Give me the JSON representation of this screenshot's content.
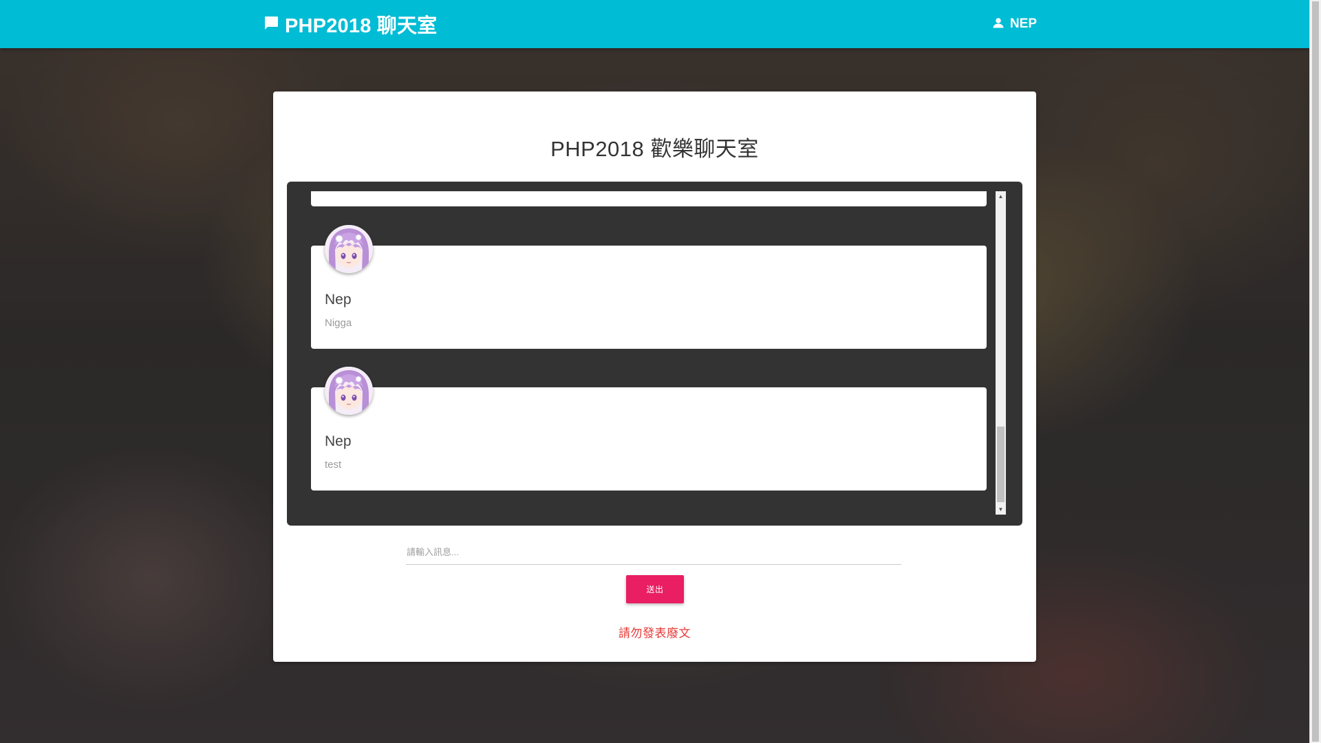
{
  "header": {
    "brand_icon": "chat-bubble-icon",
    "brand_title": "PHP2018 聊天室",
    "user_icon": "person-icon",
    "user_name": "NEP",
    "background_color": "#00bcd4"
  },
  "main": {
    "title": "PHP2018 歡樂聊天室",
    "messages": [
      {
        "name": "Nep",
        "text": "Nigga",
        "avatar_icon": "anime-avatar-icon"
      },
      {
        "name": "Nep",
        "text": "test",
        "avatar_icon": "anime-avatar-icon"
      }
    ],
    "input": {
      "placeholder": "請輸入訊息...",
      "value": ""
    },
    "send_label": "送出",
    "warning": "請勿發表廢文",
    "colors": {
      "send_button": "#e91e63",
      "warning": "#e53935",
      "chat_panel": "#333333"
    }
  }
}
